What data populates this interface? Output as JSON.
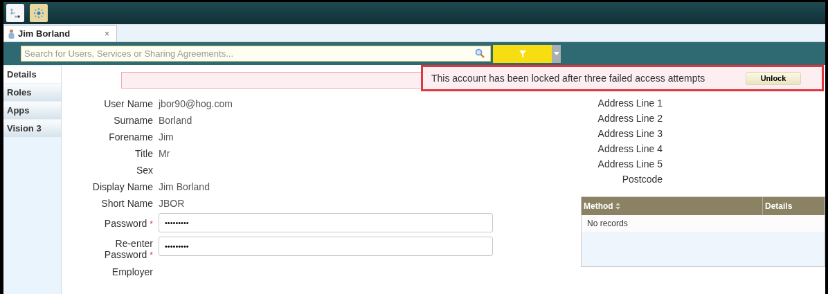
{
  "tabs": [
    {
      "label": "Jim Borland",
      "selected": true,
      "close": "×"
    }
  ],
  "search": {
    "placeholder": "Search for Users, Services or Sharing Agreements..."
  },
  "nav": [
    {
      "label": "Details",
      "selected": true
    },
    {
      "label": "Roles",
      "selected": false
    },
    {
      "label": "Apps",
      "selected": false
    },
    {
      "label": "Vision 3",
      "selected": false
    }
  ],
  "notice": {
    "message": "This account has been locked after three failed access attempts",
    "button": "Unlock"
  },
  "fields": [
    {
      "kind": "text",
      "label": "User Name",
      "value": "jbor90@hog.com"
    },
    {
      "kind": "text",
      "label": "Surname",
      "value": "Borland"
    },
    {
      "kind": "text",
      "label": "Forename",
      "value": "Jim"
    },
    {
      "kind": "text",
      "label": "Title",
      "value": "Mr"
    },
    {
      "kind": "text",
      "label": "Sex"
    },
    {
      "kind": "text",
      "label": "Display Name",
      "value": "Jim Borland"
    },
    {
      "kind": "text",
      "label": "Short Name",
      "value": "JBOR"
    },
    {
      "kind": "password",
      "label": "Password",
      "required": true,
      "value": "•••••••••"
    },
    {
      "kind": "password",
      "label": "Re-enter Password",
      "required": true,
      "value": "•••••••••"
    },
    {
      "kind": "text",
      "label": "Employer"
    }
  ],
  "required_marker": "*",
  "address": [
    "Address Line 1",
    "Address Line 2",
    "Address Line 3",
    "Address Line 4",
    "Address Line 5",
    "Postcode"
  ],
  "table": {
    "columns": [
      "Method",
      "Details"
    ],
    "empty": "No records"
  }
}
